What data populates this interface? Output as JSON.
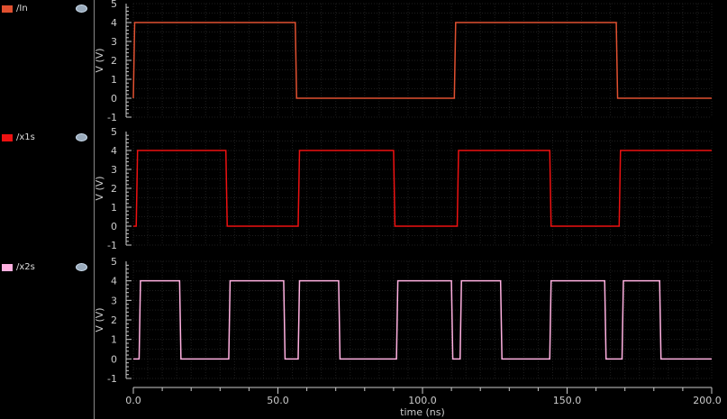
{
  "chart_data": {
    "type": "line",
    "xlabel": "time (ns)",
    "xlim": [
      0,
      200
    ],
    "xticks": [
      "0.0",
      "50.0",
      "100.0",
      "150.0",
      "200.0"
    ],
    "ylabel": "V (V)",
    "ylim": [
      -1,
      5
    ],
    "yticks": [
      "-1",
      "0",
      "1",
      "2",
      "3",
      "4",
      "5"
    ],
    "grid": true,
    "series": [
      {
        "name": "/In",
        "color": "#e05030",
        "high": 4,
        "low": 0,
        "start_low": true,
        "edges": [
          0,
          56,
          111,
          167
        ]
      },
      {
        "name": "/x1s",
        "color": "#ee1111",
        "high": 4,
        "low": 0,
        "start_low": true,
        "edges": [
          1,
          32,
          57,
          90,
          112,
          144,
          168
        ]
      },
      {
        "name": "/x2s",
        "color": "#ffb0e0",
        "high": 4,
        "low": 0,
        "start_low": true,
        "edges": [
          2,
          16,
          33,
          52,
          57,
          71,
          91,
          110,
          113,
          127,
          144,
          163,
          169,
          182
        ]
      }
    ]
  }
}
